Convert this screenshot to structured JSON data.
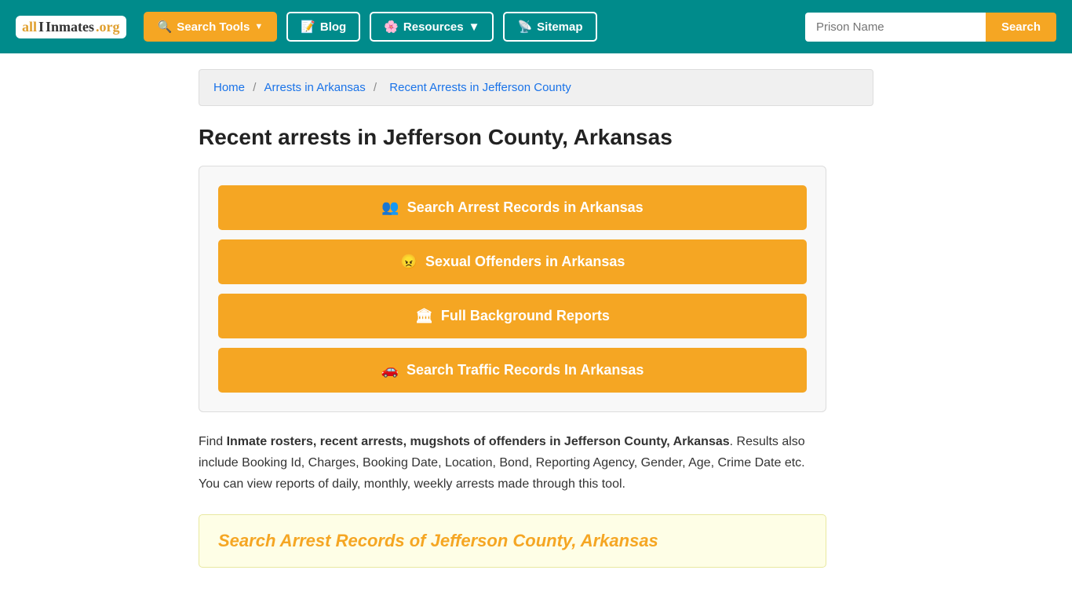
{
  "header": {
    "logo": {
      "all": "all",
      "inmates": "Inmates",
      "org": ".org"
    },
    "nav": {
      "search_tools": "Search Tools",
      "blog": "Blog",
      "resources": "Resources",
      "sitemap": "Sitemap"
    },
    "search_placeholder": "Prison Name",
    "search_button": "Search"
  },
  "breadcrumb": {
    "home": "Home",
    "arrests": "Arrests in Arkansas",
    "current": "Recent Arrests in Jefferson County"
  },
  "page_title": "Recent arrests in Jefferson County, Arkansas",
  "buttons": {
    "arrest_records": "Search Arrest Records in Arkansas",
    "sexual_offenders": "Sexual Offenders in Arkansas",
    "background_reports": "Full Background Reports",
    "traffic_records": "Search Traffic Records In Arkansas"
  },
  "description": {
    "prefix": "Find ",
    "bold": "Inmate rosters, recent arrests, mugshots of offenders in Jefferson County, Arkansas",
    "suffix": ". Results also include Booking Id, Charges, Booking Date, Location, Bond, Reporting Agency, Gender, Age, Crime Date etc. You can view reports of daily, monthly, weekly arrests made through this tool."
  },
  "search_records_box": {
    "title": "Search Arrest Records of Jefferson County, Arkansas"
  },
  "icons": {
    "search_tools": "🔍",
    "blog": "📝",
    "resources": "🌸",
    "sitemap": "📡",
    "arrest": "👥",
    "offender": "😠",
    "background": "🏛",
    "traffic": "🚗"
  }
}
